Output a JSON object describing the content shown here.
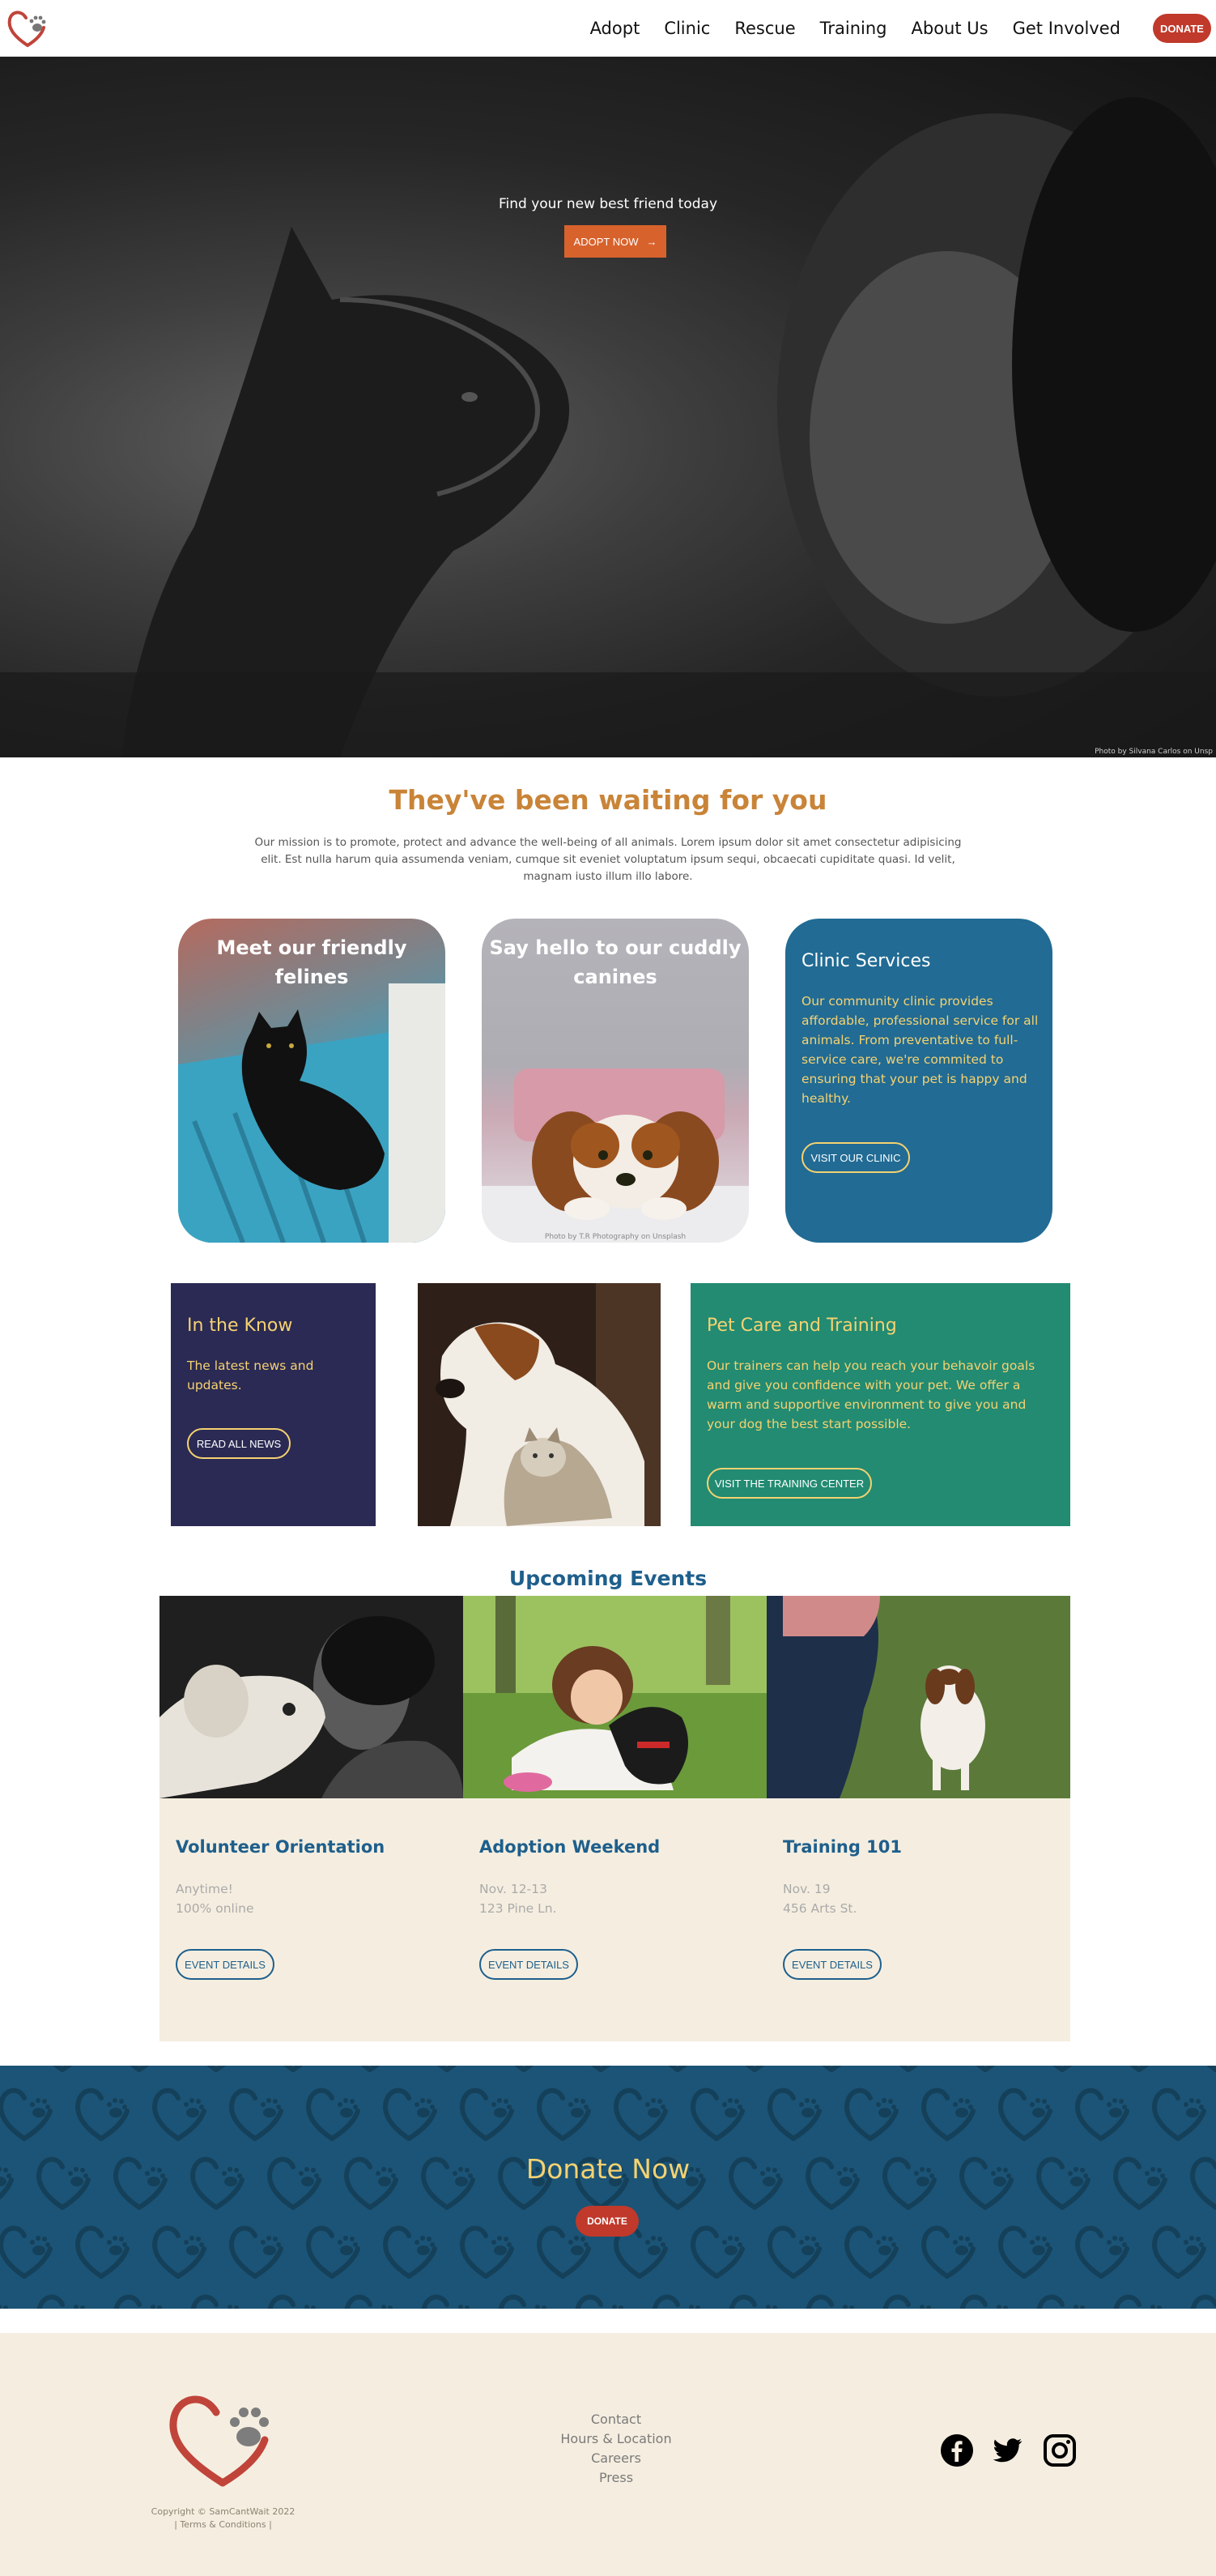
{
  "header": {
    "nav": [
      "Adopt",
      "Clinic",
      "Rescue",
      "Training",
      "About Us",
      "Get Involved"
    ],
    "donate_label": "DONATE"
  },
  "hero": {
    "tagline": "Find your new best friend today",
    "cta_label": "ADOPT NOW",
    "cta_arrow": "→",
    "photo_credit": "Photo by Silvana Carlos on Unsp"
  },
  "mission": {
    "title": "They've been waiting for you",
    "text": "Our mission is to promote, protect and advance the well-being of all animals. Lorem ipsum dolor sit amet consectetur adipisicing elit. Est nulla harum quia assumenda veniam, cumque sit eveniet voluptatum ipsum sequi, obcaecati cupiditate quasi. Id velit, magnam iusto illum illo labore."
  },
  "cards": {
    "felines_title": "Meet our friendly felines",
    "canines_title": "Say hello to our cuddly canines",
    "canines_credit": "Photo by T.R Photography on Unsplash",
    "clinic_title": "Clinic Services",
    "clinic_text": "Our community clinic provides affordable, professional service for all animals. From preventative to full-service care, we're commited to ensuring that your pet is happy and healthy.",
    "clinic_button": "VISIT OUR CLINIC"
  },
  "know": {
    "title": "In the Know",
    "text": "The latest news and updates.",
    "button": "READ ALL NEWS"
  },
  "training": {
    "title": "Pet Care and Training",
    "text": "Our trainers can help you reach your behavoir goals and give you confidence with your pet. We offer a warm and supportive environment to give you and your dog the best start possible.",
    "button": "VISIT THE TRAINING CENTER"
  },
  "events": {
    "title": "Upcoming Events",
    "items": [
      {
        "name": "Volunteer Orientation",
        "date": "Anytime!",
        "location": "100% online",
        "button": "EVENT DETAILS"
      },
      {
        "name": "Adoption Weekend",
        "date": "Nov. 12-13",
        "location": "123 Pine Ln.",
        "button": "EVENT DETAILS"
      },
      {
        "name": "Training 101",
        "date": "Nov. 19",
        "location": "456 Arts St.",
        "button": "EVENT DETAILS"
      }
    ]
  },
  "donate": {
    "title": "Donate Now",
    "button": "DONATE"
  },
  "footer": {
    "copyright": "Copyright © SamCantWait 2022",
    "terms": "| Terms & Conditions |",
    "links": [
      "Contact",
      "Hours & Location",
      "Careers",
      "Press"
    ],
    "social": [
      "facebook-icon",
      "twitter-icon",
      "instagram-icon"
    ]
  },
  "colors": {
    "brand_red": "#c0392b",
    "orange": "#d8622c",
    "gold": "#c98438",
    "yellow": "#f5d271",
    "blue": "#216b94",
    "navy": "#2b2a54",
    "teal": "#228b72",
    "cream": "#f5eee0"
  }
}
